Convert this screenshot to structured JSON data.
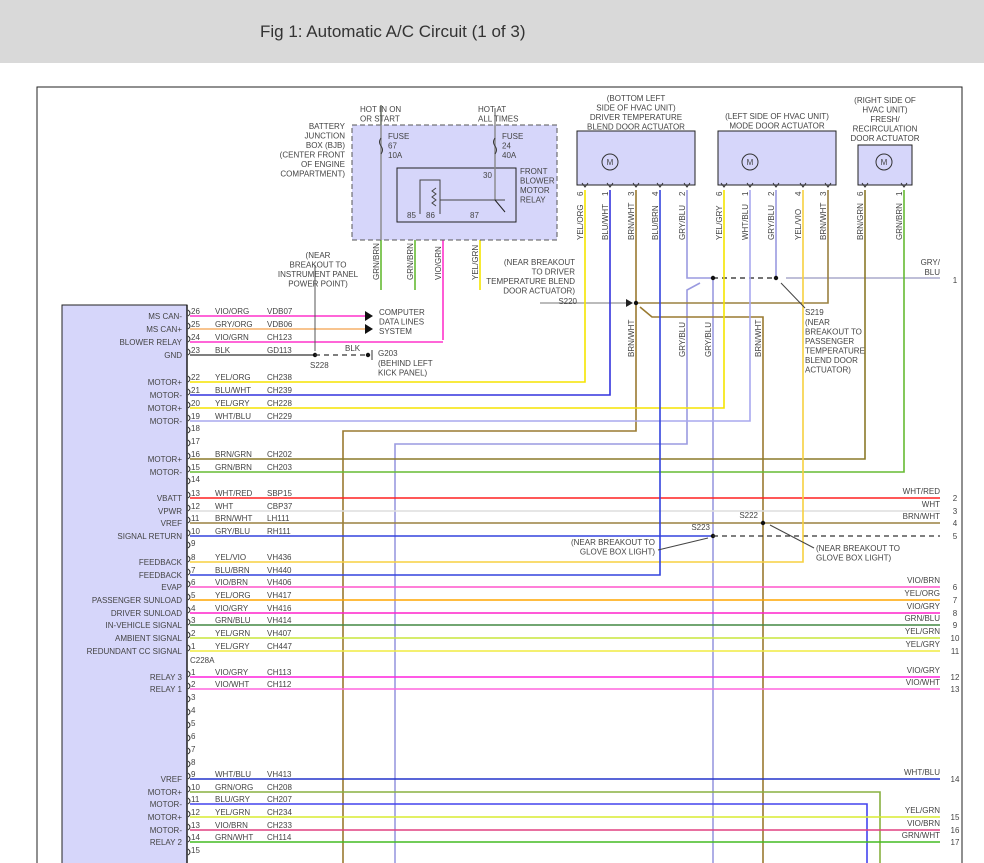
{
  "title": "Fig 1: Automatic A/C Circuit (1 of 3)",
  "bjb": {
    "label": [
      "BATTERY",
      "JUNCTION",
      "BOX (BJB)",
      "(CENTER FRONT",
      "OF ENGINE",
      "COMPARTMENT)"
    ],
    "hot_in_on": [
      "HOT IN ON",
      "OR START"
    ],
    "hot_at_all": [
      "HOT AT",
      "ALL TIMES"
    ],
    "fuse67": [
      "FUSE",
      "67",
      "10A"
    ],
    "fuse24": [
      "FUSE",
      "24",
      "40A"
    ],
    "relay_label": [
      "FRONT",
      "BLOWER",
      "MOTOR",
      "RELAY"
    ],
    "relay_pins": [
      "30",
      "85",
      "86",
      "87"
    ],
    "wires": [
      "GRN/BRN",
      "GRN/BRN",
      "VIO/GRN",
      "YEL/GRN"
    ]
  },
  "driver_actuator": {
    "label": [
      "(BOTTOM LEFT",
      "SIDE OF HVAC UNIT)",
      "DRIVER TEMPERATURE",
      "BLEND DOOR ACTUATOR"
    ],
    "pins": [
      {
        "pin": "6",
        "wire": "YEL/ORG"
      },
      {
        "pin": "1",
        "wire": "BLU/WHT"
      },
      {
        "pin": "3",
        "wire": "BRN/WHT"
      },
      {
        "pin": "4",
        "wire": "BLU/BRN"
      },
      {
        "pin": "2",
        "wire": "GRY/BLU"
      }
    ],
    "motor": "M"
  },
  "mode_actuator": {
    "label": [
      "(LEFT SIDE OF HVAC UNIT)",
      "MODE DOOR ACTUATOR"
    ],
    "pins": [
      {
        "pin": "6",
        "wire": "YEL/GRY"
      },
      {
        "pin": "1",
        "wire": "WHT/BLU"
      },
      {
        "pin": "2",
        "wire": "GRY/BLU"
      },
      {
        "pin": "4",
        "wire": "YEL/VIO"
      },
      {
        "pin": "3",
        "wire": "BRN/WHT"
      }
    ],
    "motor": "M"
  },
  "fresh_actuator": {
    "label": [
      "(RIGHT SIDE OF",
      "HVAC UNIT)",
      "FRESH/",
      "RECIRCULATION",
      "DOOR ACTUATOR"
    ],
    "pins": [
      {
        "pin": "6",
        "wire": "BRN/GRN"
      },
      {
        "pin": "1",
        "wire": "GRN/BRN"
      }
    ],
    "motor": "M"
  },
  "splices": {
    "s228": {
      "id": "S228",
      "note": [
        "(NEAR",
        "BREAKOUT TO",
        "INSTRUMENT PANEL",
        "POWER POINT)"
      ]
    },
    "g203": {
      "id": "G203",
      "note": [
        "(BEHIND LEFT",
        "KICK PANEL)"
      ],
      "wire": "BLK"
    },
    "s220": {
      "id": "S220",
      "note": [
        "(NEAR BREAKOUT",
        "TO DRIVER",
        "TEMPERATURE BLEND",
        "DOOR ACTUATOR)"
      ]
    },
    "s219": {
      "id": "S219",
      "note": [
        "(NEAR",
        "BREAKOUT TO",
        "PASSENGER",
        "TEMPERATURE",
        "BLEND DOOR",
        "ACTUATOR)"
      ]
    },
    "s223": {
      "id": "S223",
      "note": [
        "(NEAR BREAKOUT TO",
        "GLOVE BOX LIGHT)"
      ]
    },
    "s222": {
      "id": "S222",
      "note": [
        "(NEAR BREAKOUT TO",
        "GLOVE BOX LIGHT)"
      ]
    },
    "data_lines": [
      "COMPUTER",
      "DATA LINES",
      "SYSTEM"
    ]
  },
  "mid_wire_labels": [
    "BRN/WHT",
    "GRY/BLU",
    "GRY/BLU",
    "BRN/WHT"
  ],
  "connector_main": [
    {
      "pin": "26",
      "func": "MS CAN-",
      "wire": "VIO/ORG",
      "circuit": "VDB07",
      "color": "#ff33cc"
    },
    {
      "pin": "25",
      "func": "MS CAN+",
      "wire": "GRY/ORG",
      "circuit": "VDB06",
      "color": "#f5b06a"
    },
    {
      "pin": "24",
      "func": "BLOWER RELAY",
      "wire": "VIO/GRN",
      "circuit": "CH123",
      "color": "#ff33cc"
    },
    {
      "pin": "23",
      "func": "GND",
      "wire": "BLK",
      "circuit": "GD113",
      "color": "#555555"
    },
    {
      "pin": "22",
      "func": "MOTOR+",
      "wire": "YEL/ORG",
      "circuit": "CH238",
      "color": "#f5e400"
    },
    {
      "pin": "21",
      "func": "MOTOR-",
      "wire": "BLU/WHT",
      "circuit": "CH239",
      "color": "#3333dd"
    },
    {
      "pin": "20",
      "func": "MOTOR+",
      "wire": "YEL/GRY",
      "circuit": "CH228",
      "color": "#f5e400"
    },
    {
      "pin": "19",
      "func": "MOTOR-",
      "wire": "WHT/BLU",
      "circuit": "CH229",
      "color": "#a8a8ee"
    },
    {
      "pin": "18",
      "func": "",
      "wire": "",
      "circuit": "",
      "color": ""
    },
    {
      "pin": "17",
      "func": "",
      "wire": "",
      "circuit": "",
      "color": ""
    },
    {
      "pin": "16",
      "func": "MOTOR+",
      "wire": "BRN/GRN",
      "circuit": "CH202",
      "color": "#8b7a2a"
    },
    {
      "pin": "15",
      "func": "MOTOR-",
      "wire": "GRN/BRN",
      "circuit": "CH203",
      "color": "#66bb33"
    },
    {
      "pin": "14",
      "func": "",
      "wire": "",
      "circuit": "",
      "color": ""
    },
    {
      "pin": "13",
      "func": "VBATT",
      "wire": "WHT/RED",
      "circuit": "SBP15",
      "color": "#ff2020"
    },
    {
      "pin": "12",
      "func": "VPWR",
      "wire": "WHT",
      "circuit": "CBP37",
      "color": "#dddddd"
    },
    {
      "pin": "11",
      "func": "VREF",
      "wire": "BRN/WHT",
      "circuit": "LH111",
      "color": "#9a8040"
    },
    {
      "pin": "10",
      "func": "SIGNAL RETURN",
      "wire": "GRY/BLU",
      "circuit": "RH111",
      "color": "#3344dd"
    },
    {
      "pin": "9",
      "func": "",
      "wire": "",
      "circuit": "",
      "color": ""
    },
    {
      "pin": "8",
      "func": "FEEDBACK",
      "wire": "YEL/VIO",
      "circuit": "VH436",
      "color": "#f7d040"
    },
    {
      "pin": "7",
      "func": "FEEDBACK",
      "wire": "BLU/BRN",
      "circuit": "VH440",
      "color": "#3344dd"
    },
    {
      "pin": "6",
      "func": "EVAP",
      "wire": "VIO/BRN",
      "circuit": "VH406",
      "color": "#ff55cc"
    },
    {
      "pin": "5",
      "func": "PASSENGER SUNLOAD",
      "wire": "YEL/ORG",
      "circuit": "VH417",
      "color": "#ffa500"
    },
    {
      "pin": "4",
      "func": "DRIVER SUNLOAD",
      "wire": "VIO/GRY",
      "circuit": "VH416",
      "color": "#ff22cc"
    },
    {
      "pin": "3",
      "func": "IN-VEHICLE SIGNAL",
      "wire": "GRN/BLU",
      "circuit": "VH414",
      "color": "#448844"
    },
    {
      "pin": "2",
      "func": "AMBIENT SIGNAL",
      "wire": "YEL/GRN",
      "circuit": "VH407",
      "color": "#c8e63c"
    },
    {
      "pin": "1",
      "func": "REDUNDANT CC SIGNAL",
      "wire": "YEL/GRY",
      "circuit": "CH447",
      "color": "#f0ec40"
    }
  ],
  "connector_c228a_label": "C228A",
  "connector_c228a": [
    {
      "pin": "1",
      "func": "RELAY 3",
      "wire": "VIO/GRY",
      "circuit": "CH113",
      "color": "#ff22dd"
    },
    {
      "pin": "2",
      "func": "RELAY 1",
      "wire": "VIO/WHT",
      "circuit": "CH112",
      "color": "#ff66dd"
    },
    {
      "pin": "3",
      "func": "",
      "wire": "",
      "circuit": "",
      "color": ""
    },
    {
      "pin": "4",
      "func": "",
      "wire": "",
      "circuit": "",
      "color": ""
    },
    {
      "pin": "5",
      "func": "",
      "wire": "",
      "circuit": "",
      "color": ""
    },
    {
      "pin": "6",
      "func": "",
      "wire": "",
      "circuit": "",
      "color": ""
    },
    {
      "pin": "7",
      "func": "",
      "wire": "",
      "circuit": "",
      "color": ""
    },
    {
      "pin": "8",
      "func": "",
      "wire": "",
      "circuit": "",
      "color": ""
    },
    {
      "pin": "9",
      "func": "VREF",
      "wire": "WHT/BLU",
      "circuit": "VH413",
      "color": "#2233cc"
    },
    {
      "pin": "10",
      "func": "MOTOR+",
      "wire": "GRN/ORG",
      "circuit": "CH208",
      "color": "#88b040"
    },
    {
      "pin": "11",
      "func": "MOTOR-",
      "wire": "BLU/GRY",
      "circuit": "CH207",
      "color": "#4444ee"
    },
    {
      "pin": "12",
      "func": "MOTOR+",
      "wire": "YEL/GRN",
      "circuit": "CH234",
      "color": "#d8ec30"
    },
    {
      "pin": "13",
      "func": "MOTOR-",
      "wire": "VIO/BRN",
      "circuit": "CH233",
      "color": "#e04080"
    },
    {
      "pin": "14",
      "func": "RELAY 2",
      "wire": "GRN/WHT",
      "circuit": "CH114",
      "color": "#44bb22"
    },
    {
      "pin": "15",
      "func": "",
      "wire": "",
      "circuit": "",
      "color": ""
    }
  ],
  "right_labels": [
    {
      "num": "1",
      "wire": "GRY/ BLU"
    },
    {
      "num": "2",
      "wire": "WHT/RED"
    },
    {
      "num": "3",
      "wire": "WHT"
    },
    {
      "num": "4",
      "wire": "BRN/WHT"
    },
    {
      "num": "5",
      "wire": ""
    },
    {
      "num": "6",
      "wire": "VIO/BRN"
    },
    {
      "num": "7",
      "wire": "YEL/ORG"
    },
    {
      "num": "8",
      "wire": "VIO/GRY"
    },
    {
      "num": "9",
      "wire": "GRN/BLU"
    },
    {
      "num": "10",
      "wire": "YEL/GRN"
    },
    {
      "num": "11",
      "wire": "YEL/GRY"
    },
    {
      "num": "12",
      "wire": "VIO/GRY"
    },
    {
      "num": "13",
      "wire": "VIO/WHT"
    },
    {
      "num": "14",
      "wire": "WHT/BLU"
    },
    {
      "num": "15",
      "wire": "YEL/GRN"
    },
    {
      "num": "16",
      "wire": "VIO/BRN"
    },
    {
      "num": "17",
      "wire": "GRN/WHT"
    }
  ]
}
